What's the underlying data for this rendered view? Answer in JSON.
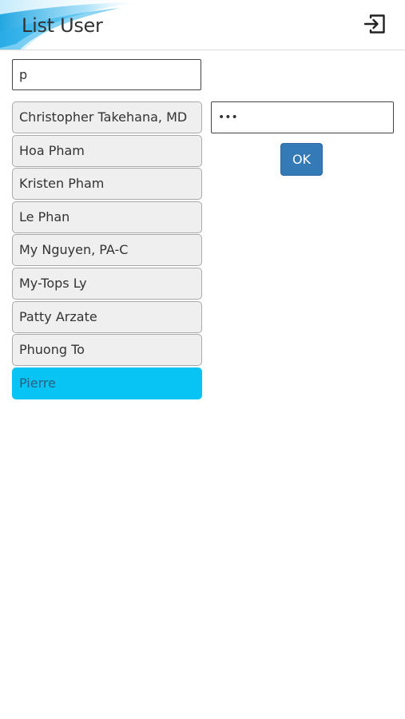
{
  "header": {
    "title": "List User",
    "logout_icon": "logout-icon"
  },
  "search": {
    "value": "p"
  },
  "users": [
    {
      "label": "Christopher Takehana, MD",
      "selected": false
    },
    {
      "label": "Hoa Pham",
      "selected": false
    },
    {
      "label": "Kristen Pham",
      "selected": false
    },
    {
      "label": "Le Phan",
      "selected": false
    },
    {
      "label": "My Nguyen, PA-C",
      "selected": false
    },
    {
      "label": "My-Tops Ly",
      "selected": false
    },
    {
      "label": "Patty Arzate",
      "selected": false
    },
    {
      "label": "Phuong To",
      "selected": false
    },
    {
      "label": "Pierre",
      "selected": true
    }
  ],
  "password": {
    "value": "•••"
  },
  "ok_button": {
    "label": "OK"
  },
  "colors": {
    "selected_item": "#08c4f4",
    "ok_button": "#337ab7",
    "item_background": "#efefef"
  }
}
